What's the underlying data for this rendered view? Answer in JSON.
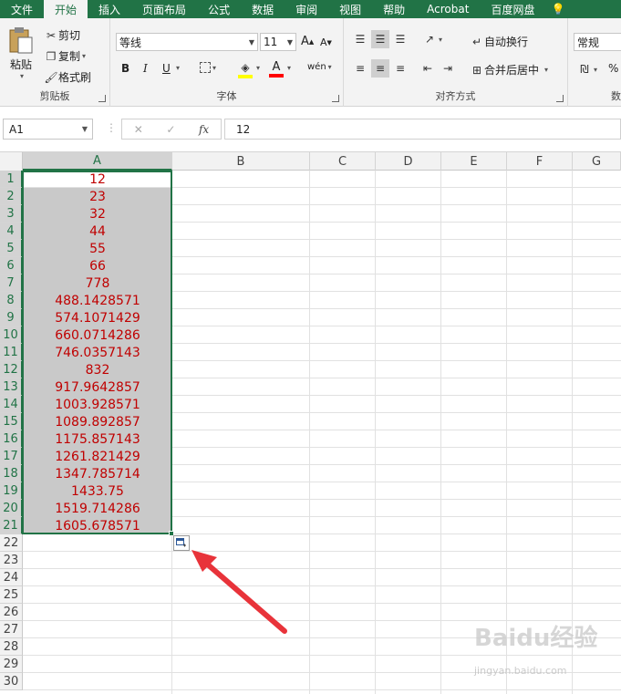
{
  "ribbon": {
    "tabs": [
      "文件",
      "开始",
      "插入",
      "页面布局",
      "公式",
      "数据",
      "审阅",
      "视图",
      "帮助",
      "Acrobat",
      "百度网盘"
    ],
    "active_tab": "开始",
    "clipboard": {
      "paste": "粘贴",
      "cut": "剪切",
      "copy": "复制",
      "format_painter": "格式刷",
      "label": "剪贴板"
    },
    "font": {
      "name": "等线",
      "size": "11",
      "bold": "B",
      "italic": "I",
      "underline": "U",
      "label": "字体"
    },
    "alignment": {
      "wrap_text": "自动换行",
      "merge_center": "合并后居中",
      "label": "对齐方式"
    },
    "number": {
      "format": "常规",
      "percent": "%",
      "label": "数"
    },
    "colors": {
      "accent": "#217346",
      "font_color": "#ff0000",
      "fill_color": "#ffff00"
    }
  },
  "formula_bar": {
    "name_box": "A1",
    "cancel": "✕",
    "enter": "✓",
    "fx": "fx",
    "value": "12"
  },
  "columns": [
    "A",
    "B",
    "C",
    "D",
    "E",
    "F",
    "G"
  ],
  "rows": [
    {
      "n": "1",
      "a": "12"
    },
    {
      "n": "2",
      "a": "23"
    },
    {
      "n": "3",
      "a": "32"
    },
    {
      "n": "4",
      "a": "44"
    },
    {
      "n": "5",
      "a": "55"
    },
    {
      "n": "6",
      "a": "66"
    },
    {
      "n": "7",
      "a": "778"
    },
    {
      "n": "8",
      "a": "488.1428571"
    },
    {
      "n": "9",
      "a": "574.1071429"
    },
    {
      "n": "10",
      "a": "660.0714286"
    },
    {
      "n": "11",
      "a": "746.0357143"
    },
    {
      "n": "12",
      "a": "832"
    },
    {
      "n": "13",
      "a": "917.9642857"
    },
    {
      "n": "14",
      "a": "1003.928571"
    },
    {
      "n": "15",
      "a": "1089.892857"
    },
    {
      "n": "16",
      "a": "1175.857143"
    },
    {
      "n": "17",
      "a": "1261.821429"
    },
    {
      "n": "18",
      "a": "1347.785714"
    },
    {
      "n": "19",
      "a": "1433.75"
    },
    {
      "n": "20",
      "a": "1519.714286"
    },
    {
      "n": "21",
      "a": "1605.678571"
    },
    {
      "n": "22",
      "a": ""
    },
    {
      "n": "23",
      "a": ""
    },
    {
      "n": "24",
      "a": ""
    },
    {
      "n": "25",
      "a": ""
    },
    {
      "n": "26",
      "a": ""
    },
    {
      "n": "27",
      "a": ""
    },
    {
      "n": "28",
      "a": ""
    },
    {
      "n": "29",
      "a": ""
    },
    {
      "n": "30",
      "a": ""
    }
  ],
  "selection": {
    "range": "A1:A21"
  },
  "watermark": {
    "main": "Baidu经验",
    "sub": "jingyan.baidu.com"
  }
}
